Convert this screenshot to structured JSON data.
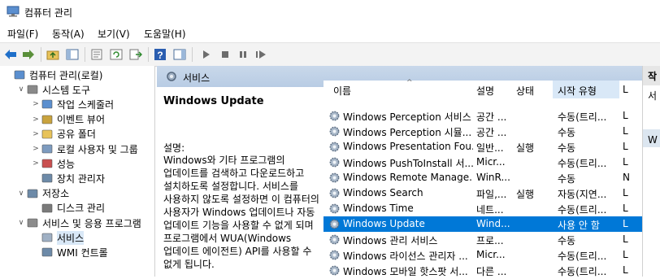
{
  "window": {
    "title": "컴퓨터 관리"
  },
  "menu": [
    "파일(F)",
    "동작(A)",
    "보기(V)",
    "도움말(H)"
  ],
  "tree": [
    {
      "label": "컴퓨터 관리(로컬)",
      "level": 0,
      "expand": ""
    },
    {
      "label": "시스템 도구",
      "level": 1,
      "expand": "∨"
    },
    {
      "label": "작업 스케줄러",
      "level": 2,
      "expand": ">"
    },
    {
      "label": "이벤트 뷰어",
      "level": 2,
      "expand": ">"
    },
    {
      "label": "공유 폴더",
      "level": 2,
      "expand": ">"
    },
    {
      "label": "로컬 사용자 및 그룹",
      "level": 2,
      "expand": ">"
    },
    {
      "label": "성능",
      "level": 2,
      "expand": ">"
    },
    {
      "label": "장치 관리자",
      "level": 2,
      "expand": ""
    },
    {
      "label": "저장소",
      "level": 1,
      "expand": "∨"
    },
    {
      "label": "디스크 관리",
      "level": 2,
      "expand": ""
    },
    {
      "label": "서비스 및 응용 프로그램",
      "level": 1,
      "expand": "∨"
    },
    {
      "label": "서비스",
      "level": 2,
      "expand": "",
      "selected": true
    },
    {
      "label": "WMI 컨트롤",
      "level": 2,
      "expand": ""
    }
  ],
  "services_header": "서비스",
  "description": {
    "name": "Windows Update",
    "label": "설명:",
    "text": "Windows와 기타 프로그램의 업데이트를 검색하고 다운로드하고 설치하도록 설정합니다. 서비스를 사용하지 않도록 설정하면 이 컴퓨터의 사용자가 Windows 업데이트나 자동 업데이트 기능을 사용할 수 없게 되며 프로그램에서 WUA(Windows 업데이트 에이전트) API를 사용할 수 없게 됩니다."
  },
  "columns": {
    "name": "이름",
    "desc": "설명",
    "status": "상태",
    "startup": "시작 유형",
    "logon": "L"
  },
  "services": [
    {
      "name": "Windows Perception 서비스",
      "desc": "공간 ...",
      "status": "",
      "startup": "수동(트리...",
      "logon": "L"
    },
    {
      "name": "Windows Perception 시뮬...",
      "desc": "공간 ...",
      "status": "",
      "startup": "수동",
      "logon": "L"
    },
    {
      "name": "Windows Presentation Fou...",
      "desc": "일반...",
      "status": "실행",
      "startup": "수동",
      "logon": "L"
    },
    {
      "name": "Windows PushToInstall 서...",
      "desc": "Micr...",
      "status": "",
      "startup": "수동(트리...",
      "logon": "L"
    },
    {
      "name": "Windows Remote Manage...",
      "desc": "WinR...",
      "status": "",
      "startup": "수동",
      "logon": "N"
    },
    {
      "name": "Windows Search",
      "desc": "파일,...",
      "status": "실행",
      "startup": "자동(지연...",
      "logon": "L"
    },
    {
      "name": "Windows Time",
      "desc": "네트...",
      "status": "",
      "startup": "수동(트리...",
      "logon": "L"
    },
    {
      "name": "Windows Update",
      "desc": "Wind...",
      "status": "",
      "startup": "사용 안 함",
      "logon": "L",
      "selected": true
    },
    {
      "name": "Windows 관리 서비스",
      "desc": "프로...",
      "status": "",
      "startup": "수동",
      "logon": "L"
    },
    {
      "name": "Windows 라이선스 관리자 ...",
      "desc": "Micr...",
      "status": "",
      "startup": "수동(트리...",
      "logon": "L"
    },
    {
      "name": "Windows 모바일 핫스팟 서...",
      "desc": "다른 ...",
      "status": "",
      "startup": "수동(트리...",
      "logon": "L"
    }
  ],
  "right_pane": {
    "title": "작",
    "row1": "서",
    "row2": "W"
  },
  "colors": {
    "selection": "#0078d7",
    "header_blue": "#c9d8ea",
    "column_selected": "#d9e8f7"
  }
}
